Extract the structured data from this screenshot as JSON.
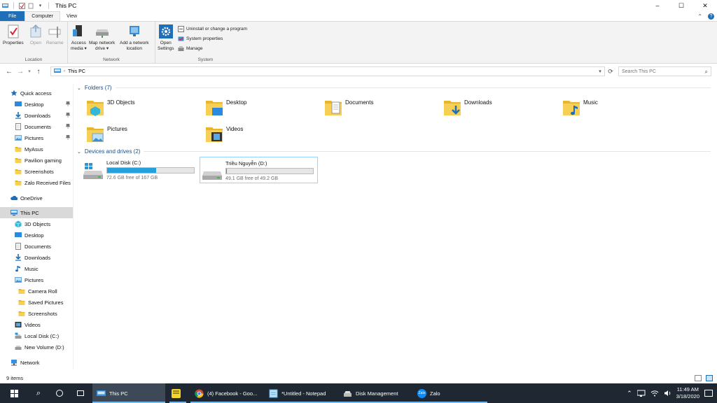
{
  "window": {
    "title": "This PC",
    "controls": {
      "minimize": "–",
      "maximize": "☐",
      "close": "✕"
    }
  },
  "ribbon_tabs": [
    {
      "label": "File"
    },
    {
      "label": "Computer"
    },
    {
      "label": "View"
    }
  ],
  "ribbon": {
    "location_group": {
      "label": "Location",
      "properties": "Properties",
      "open": "Open",
      "rename": "Rename"
    },
    "network_group": {
      "label": "Network",
      "access_media_l1": "Access",
      "access_media_l2": "media ▾",
      "map_drive_l1": "Map network",
      "map_drive_l2": "drive ▾",
      "add_location_l1": "Add a network",
      "add_location_l2": "location"
    },
    "system_group": {
      "label": "System",
      "open_settings_l1": "Open",
      "open_settings_l2": "Settings",
      "uninstall": "Uninstall or change a program",
      "system_properties": "System properties",
      "manage": "Manage"
    }
  },
  "address": {
    "path": "This PC",
    "search_placeholder": "Search This PC"
  },
  "nav_pane": {
    "quick_access": "Quick access",
    "quick_items": [
      {
        "label": "Desktop",
        "pinned": true
      },
      {
        "label": "Downloads",
        "pinned": true
      },
      {
        "label": "Documents",
        "pinned": true
      },
      {
        "label": "Pictures",
        "pinned": true
      },
      {
        "label": "MyAsus",
        "pinned": false
      },
      {
        "label": "Pavilion gaming",
        "pinned": false
      },
      {
        "label": "Screenshots",
        "pinned": false
      },
      {
        "label": "Zalo Received Files",
        "pinned": false
      }
    ],
    "onedrive": "OneDrive",
    "this_pc": "This PC",
    "pc_items": [
      {
        "label": "3D Objects"
      },
      {
        "label": "Desktop"
      },
      {
        "label": "Documents"
      },
      {
        "label": "Downloads"
      },
      {
        "label": "Music"
      },
      {
        "label": "Pictures"
      },
      {
        "label": "Camera Roll"
      },
      {
        "label": "Saved Pictures"
      },
      {
        "label": "Screenshots"
      },
      {
        "label": "Videos"
      },
      {
        "label": "Local Disk (C:)"
      },
      {
        "label": "New Volume (D:)"
      }
    ],
    "network": "Network"
  },
  "folders_section": {
    "header": "Folders (7)",
    "folders": [
      {
        "name": "3D Objects"
      },
      {
        "name": "Desktop"
      },
      {
        "name": "Documents"
      },
      {
        "name": "Downloads"
      },
      {
        "name": "Music"
      },
      {
        "name": "Pictures"
      },
      {
        "name": "Videos"
      }
    ]
  },
  "drives_section": {
    "header": "Devices and drives (2)",
    "drives": [
      {
        "name": "Local Disk (C:)",
        "free_text": "72.6 GB free of 167 GB",
        "used_fraction": 0.565
      },
      {
        "name": "Triều Nguyễn (D:)",
        "free_text": "49.1 GB free of 49.2 GB",
        "used_fraction": 0.002
      }
    ]
  },
  "status": {
    "item_count": "9 items"
  },
  "taskbar": {
    "apps": [
      {
        "label": "This PC",
        "active": true
      },
      {
        "label": "",
        "active": false
      },
      {
        "label": "(4) Facebook - Goo...",
        "active": false
      },
      {
        "label": "*Untitled - Notepad",
        "active": false
      },
      {
        "label": "Disk Management",
        "active": false
      },
      {
        "label": "Zalo",
        "active": false
      }
    ],
    "zalo_icon_text": "Zalo",
    "time": "11:49 AM",
    "date": "3/18/2020"
  },
  "colors": {
    "accent": "#1e6fb8",
    "drive_bar": "#26a0da",
    "folder": "#f5c342",
    "taskbar": "#1f2832"
  }
}
